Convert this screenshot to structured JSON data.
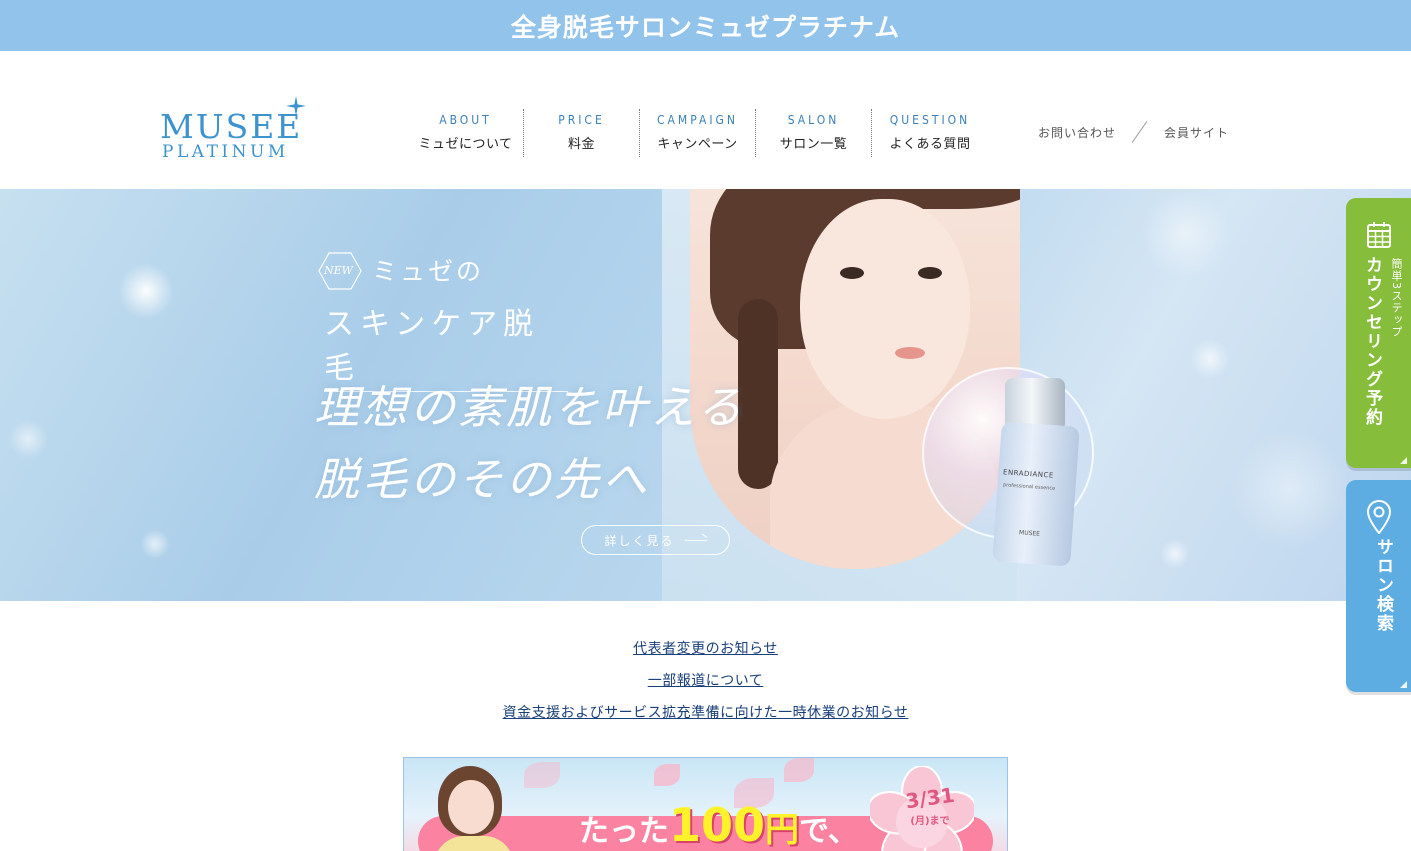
{
  "banner": {
    "title": "全身脱毛サロンミュゼプラチナム"
  },
  "logo": {
    "line1": "MUSEE",
    "line2": "PLATINUM"
  },
  "nav": {
    "items": [
      {
        "en": "ABOUT",
        "ja": "ミュゼについて"
      },
      {
        "en": "PRICE",
        "ja": "料金"
      },
      {
        "en": "CAMPAIGN",
        "ja": "キャンペーン"
      },
      {
        "en": "SALON",
        "ja": "サロン一覧"
      },
      {
        "en": "QUESTION",
        "ja": "よくある質問"
      }
    ]
  },
  "utility": {
    "contact": "お問い合わせ",
    "member": "会員サイト"
  },
  "hero": {
    "badge": "NEW",
    "sub1": "ミュゼの",
    "sub2": "スキンケア脱毛",
    "catch_line1": "理想の素肌を叶える",
    "catch_line2": "脱毛のその先へ",
    "detail_button": "詳しく見る",
    "product": {
      "name": "ENRADIANCE",
      "sub": "professional essence",
      "brand": "MUSEE"
    }
  },
  "side_tabs": {
    "counseling": {
      "sub": "簡単3ステップ",
      "main": "カウンセリング予約",
      "icon": "calendar-icon"
    },
    "salon": {
      "main": "サロン検索",
      "icon": "map-pin-icon"
    }
  },
  "notices": [
    "代表者変更のお知らせ",
    "一部報道について",
    "資金支援およびサービス拡充準備に向けた一時休業のお知らせ"
  ],
  "campaign": {
    "prefix": "たった",
    "amount": "100",
    "unit": "円",
    "suffix": "で、",
    "date_main": "3/31",
    "date_sub": "(月)まで"
  },
  "colors": {
    "banner": "#92c3ea",
    "accent_blue": "#3c93cd",
    "green_tab": "#86bd3b",
    "blue_tab": "#5dade2",
    "link": "#1a3f7a",
    "pink": "#fb82a0"
  }
}
